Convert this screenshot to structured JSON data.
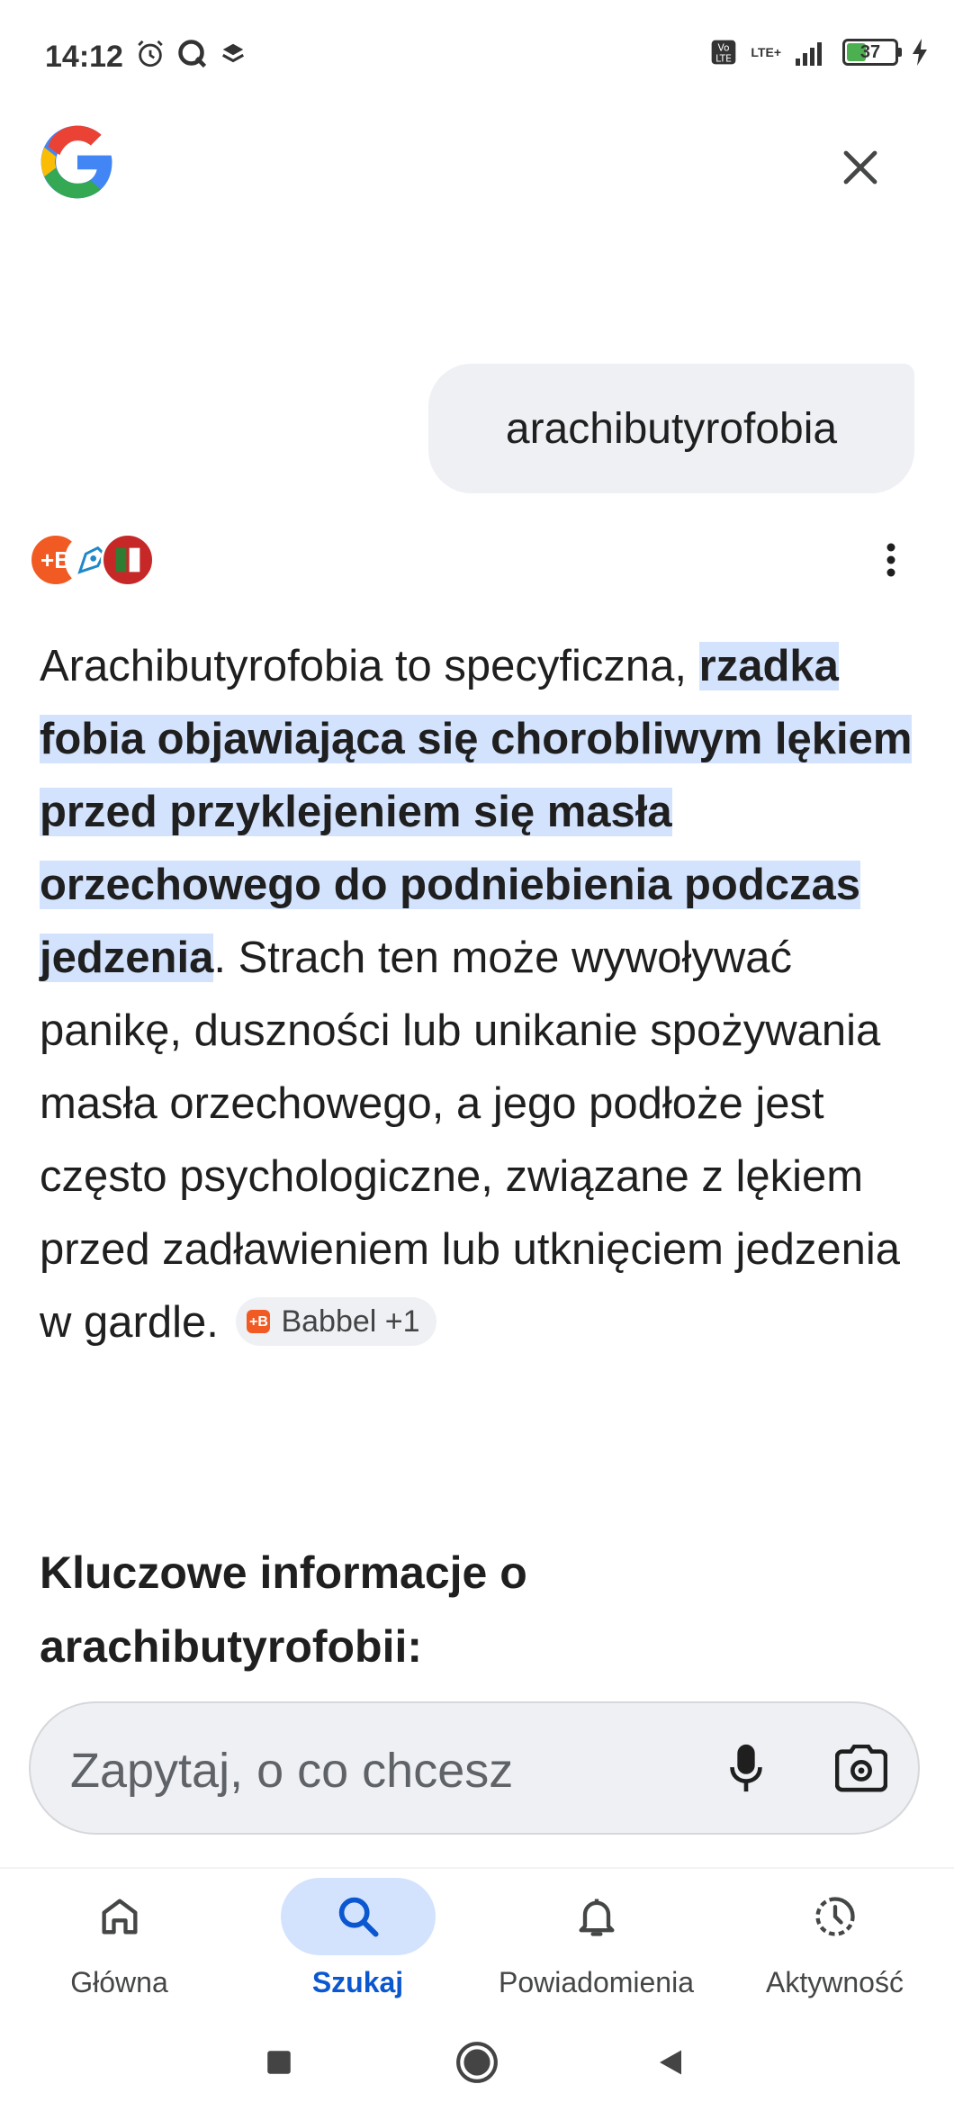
{
  "status_bar": {
    "time": "14:12",
    "battery": "37",
    "network": "LTE+"
  },
  "header": {
    "logo_icon": "google-g-logo",
    "close_icon": "close-icon"
  },
  "query": {
    "text": "arachibutyrofobia"
  },
  "answer": {
    "intro": "Arachibutyrofobia to specyficzna, ",
    "highlight": "rzadka fobia objawiająca się chorobliwym lękiem przed przyklejeniem się masła orzechowego do podniebienia podczas jedzenia",
    "rest": ". Strach ten może wywoływać panikę, duszności lub unikanie spożywania masła orzechowego, a jego podłoże jest często psychologiczne, związane z lękiem przed zadławieniem lub utknięciem jedzenia w gardle.",
    "source_chip": "Babbel +1"
  },
  "section": {
    "heading": "Kluczowe informacje o arachibutyrofobii:"
  },
  "search": {
    "placeholder": "Zapytaj, o co chcesz"
  },
  "nav": {
    "items": [
      {
        "label": "Główna",
        "icon": "home-icon",
        "active": false
      },
      {
        "label": "Szukaj",
        "icon": "search-icon",
        "active": true
      },
      {
        "label": "Powiadomienia",
        "icon": "bell-icon",
        "active": false
      },
      {
        "label": "Aktywność",
        "icon": "activity-icon",
        "active": false
      }
    ]
  },
  "colors": {
    "highlight": "#d3e3fd",
    "active_nav": "#0b57d0",
    "bubble_bg": "#eef0f4"
  }
}
